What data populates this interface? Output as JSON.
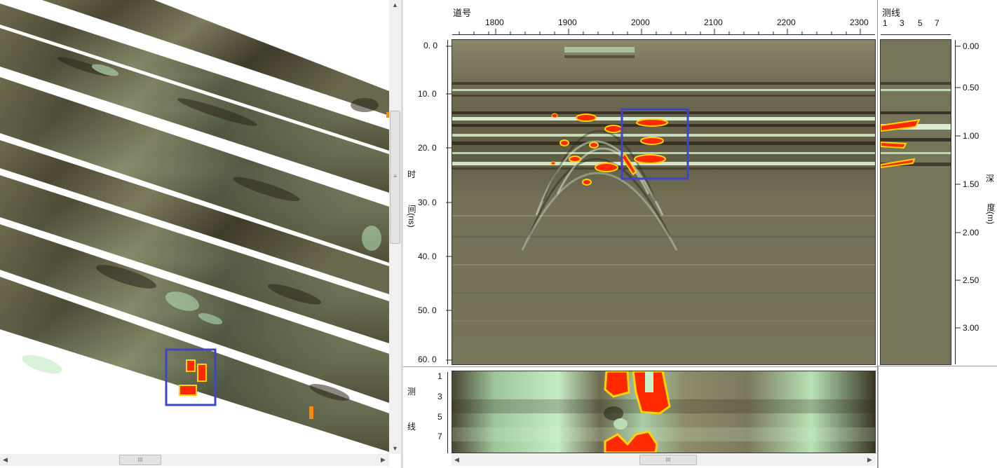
{
  "colors": {
    "radar_base": "#7a775a",
    "radar_light": "#c8f0c8",
    "radar_dark": "#2e2a1c",
    "anomaly_red": "#ff2a00",
    "anomaly_yellow": "#ffd400",
    "selection_box": "#3b46c8"
  },
  "left_view": {
    "scrollbar_grip": "III"
  },
  "profile": {
    "x_axis_title": "道号",
    "x_ticks": [
      "1800",
      "1900",
      "2000",
      "2100",
      "2200",
      "2300"
    ],
    "y_ticks": [
      "0. 0",
      "10. 0",
      "20. 0",
      "30. 0",
      "40. 0",
      "50. 0",
      "60. 0"
    ],
    "y_label_1": "时",
    "y_label_2": "间(ns)"
  },
  "line_panel": {
    "title": "测线",
    "ticks": [
      "1",
      "3",
      "5",
      "7"
    ]
  },
  "depth_axis": {
    "ticks": [
      "0.00",
      "0.50",
      "1.00",
      "1.50",
      "2.00",
      "2.50",
      "3.00"
    ],
    "label_1": "深",
    "label_2": "度(m)"
  },
  "slice_panel": {
    "y_ticks": [
      "1",
      "3",
      "5",
      "7"
    ],
    "label_1": "测",
    "label_2": "线"
  },
  "bottom_scroll": {
    "grip": "III"
  }
}
